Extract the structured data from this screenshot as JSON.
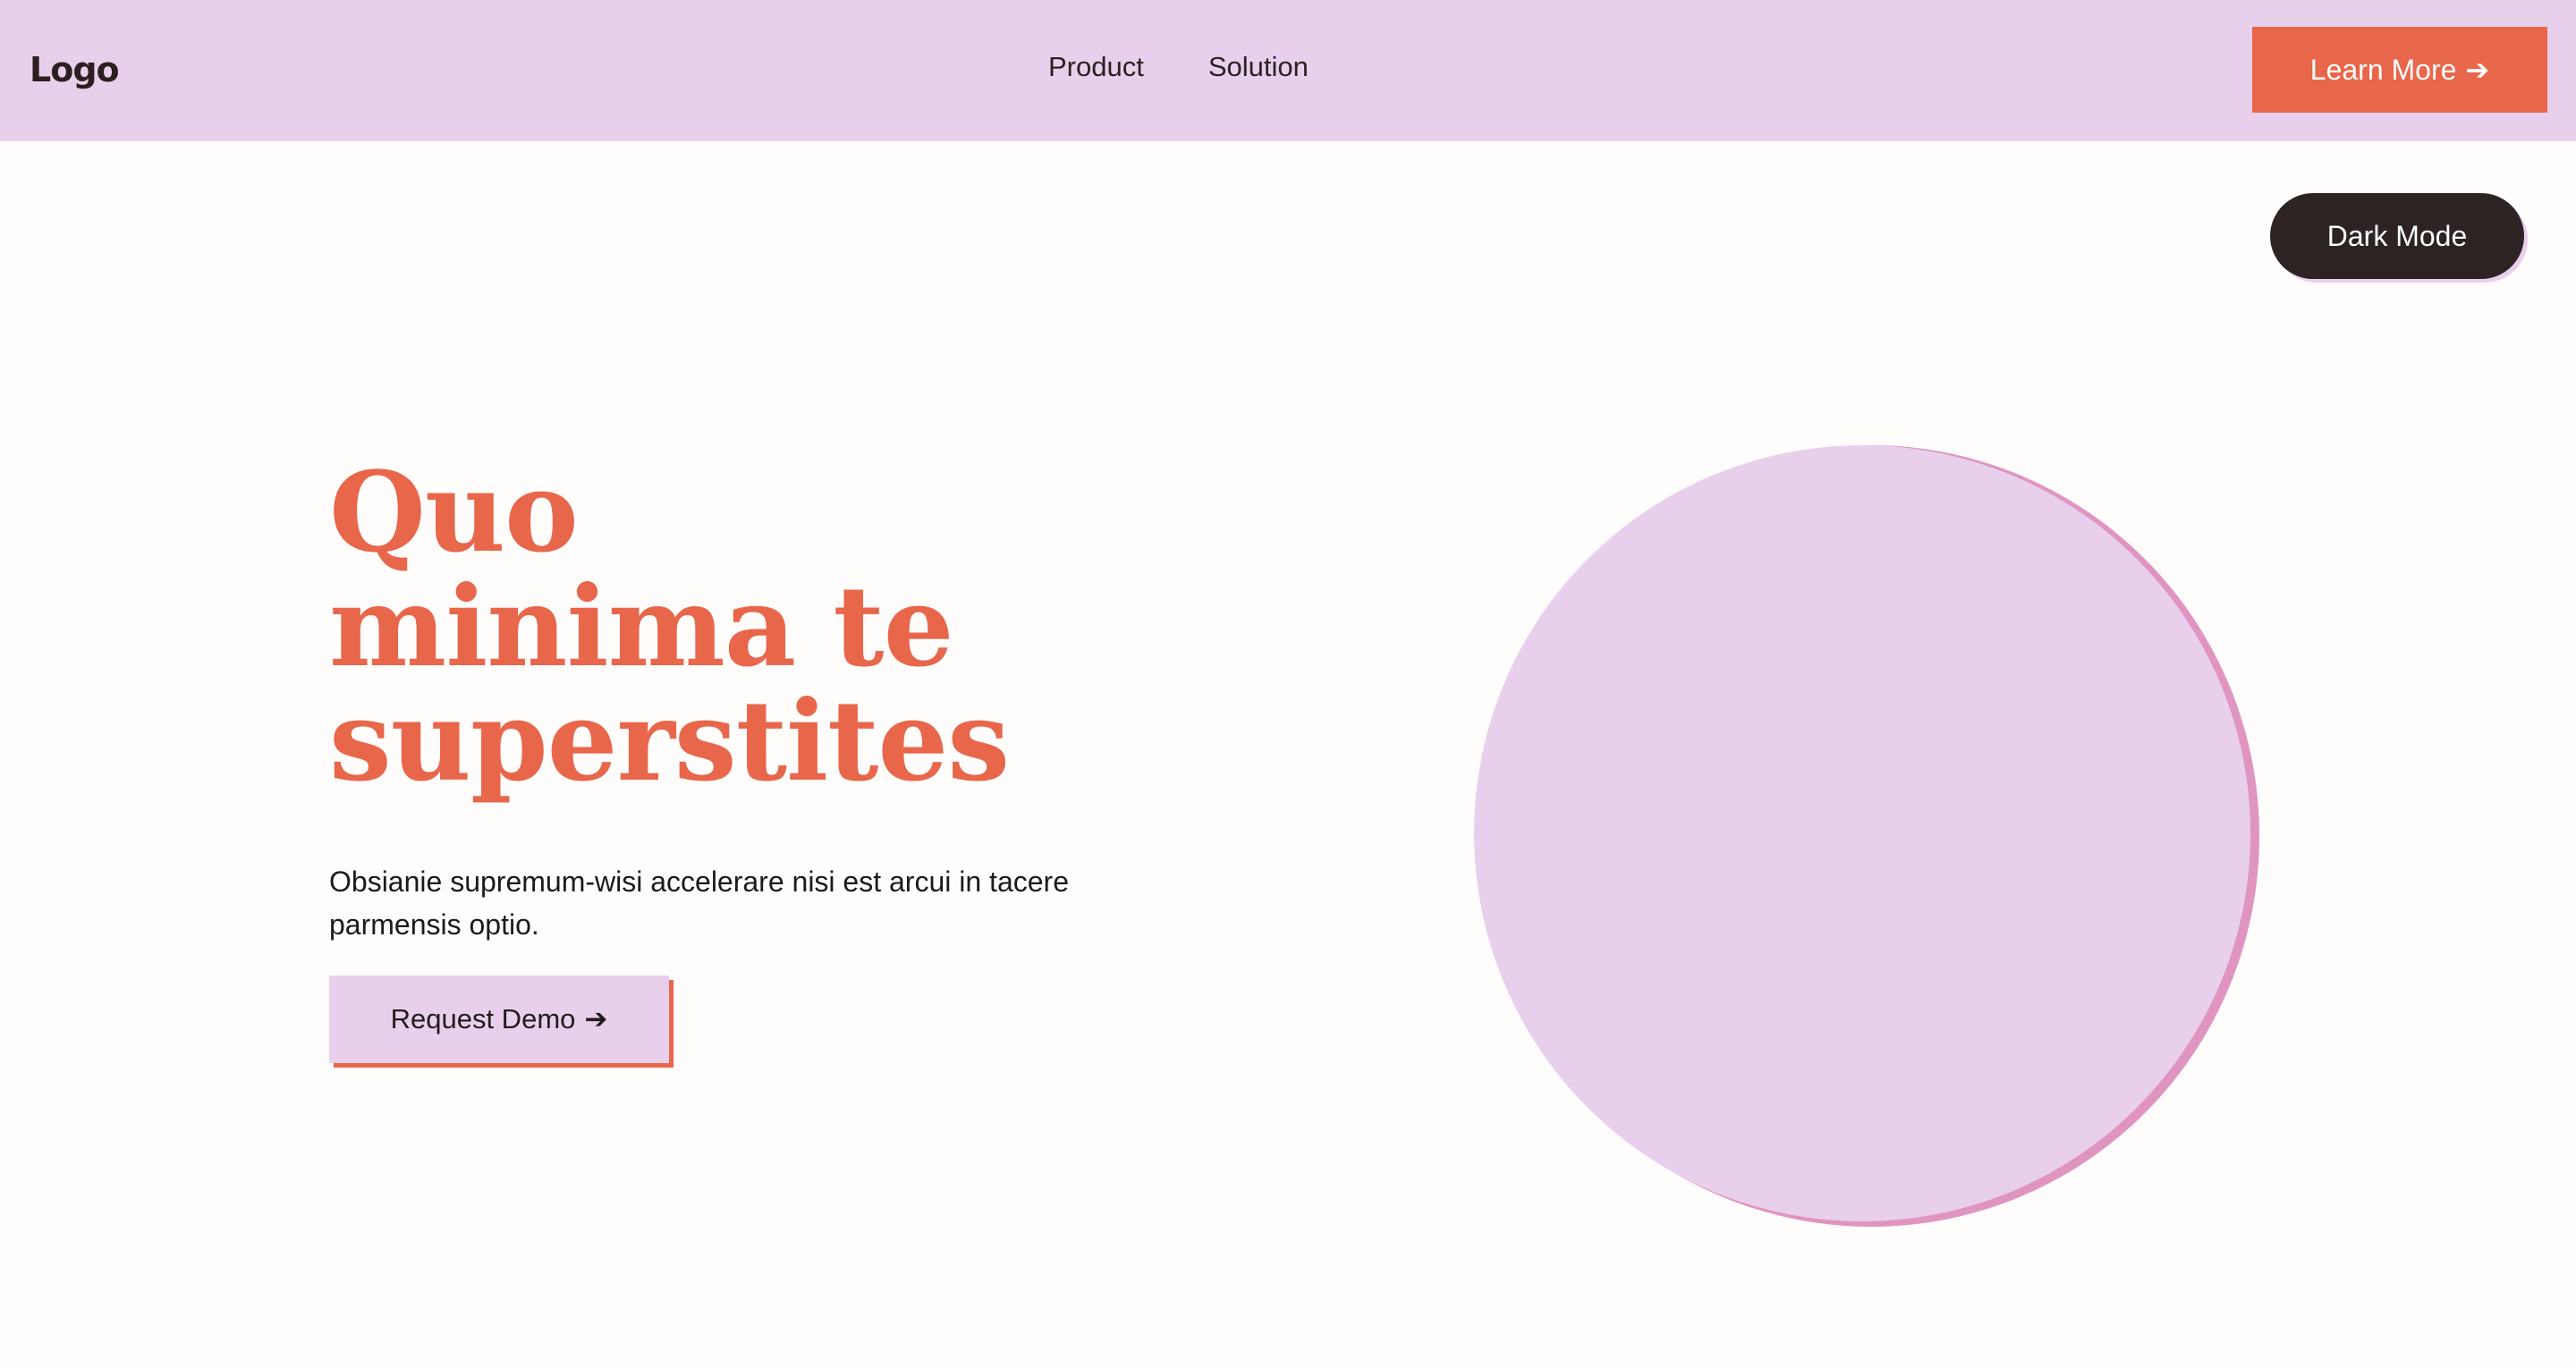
{
  "header": {
    "logo": "Logo",
    "nav": [
      {
        "label": "Product"
      },
      {
        "label": "Solution"
      }
    ],
    "cta": {
      "label": "Learn More",
      "arrow": "➔"
    }
  },
  "theme_toggle": {
    "label": "Dark Mode"
  },
  "hero": {
    "title_lines": [
      "Quo",
      "minima te",
      "superstites"
    ],
    "description": "Obsianie supremum-wisi accelerare nisi est arcui in tacere parmensis optio.",
    "demo_button": {
      "label": "Request Demo",
      "arrow": "➔"
    }
  },
  "colors": {
    "accent": "#e8664a",
    "lavender": "#e8d0ec",
    "pink_shadow": "#e095c0",
    "dark": "#2d2323",
    "background": "#fffcfc"
  }
}
